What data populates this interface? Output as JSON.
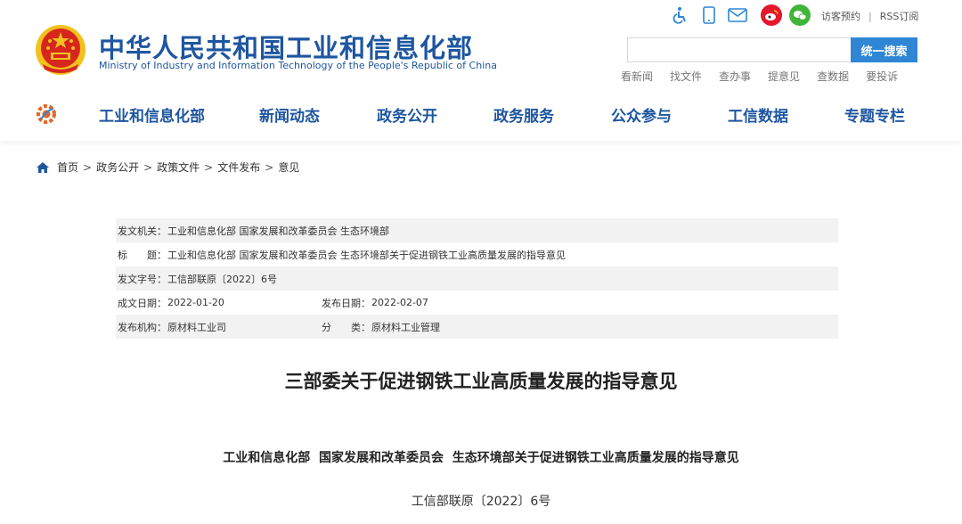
{
  "site": {
    "title": "中华人民共和国工业和信息化部",
    "subtitle": "Ministry of Industry and Information Technology of the People's Republic of China"
  },
  "top_bar": {
    "icons": [
      "accessibility-icon",
      "mobile-phone-icon",
      "mail-icon",
      "weibo-icon",
      "wechat-icon"
    ],
    "links": [
      "访客预约",
      "RSS订阅"
    ]
  },
  "search": {
    "placeholder": "",
    "button_label": "统一搜索"
  },
  "quick_links": [
    "看新闻",
    "找文件",
    "查办事",
    "提意见",
    "查数据",
    "要投诉"
  ],
  "nav": {
    "items": [
      "工业和信息化部",
      "新闻动态",
      "政务公开",
      "政务服务",
      "公众参与",
      "工信数据",
      "专题专栏"
    ]
  },
  "breadcrumb": [
    "首页",
    "政务公开",
    "政策文件",
    "文件发布",
    "意见"
  ],
  "meta": {
    "issuer": {
      "label": "发文机关：",
      "value": "工业和信息化部 国家发展和改革委员会 生态环境部"
    },
    "title": {
      "label": "标　　题：",
      "value": "工业和信息化部 国家发展和改革委员会 生态环境部关于促进钢铁工业高质量发展的指导意见"
    },
    "doc_no": {
      "label": "发文字号：",
      "value": "工信部联原〔2022〕6号"
    },
    "created": {
      "label": "成文日期：",
      "value": "2022-01-20"
    },
    "published": {
      "label": "发布日期：",
      "value": "2022-02-07"
    },
    "org": {
      "label": "发布机构：",
      "value": "原材料工业司"
    },
    "category": {
      "label": "分　　类：",
      "value": "原材料工业管理"
    }
  },
  "article": {
    "title": "三部委关于促进钢铁工业高质量发展的指导意见",
    "heading": "工业和信息化部  国家发展和改革委员会  生态环境部关于促进钢铁工业高质量发展的指导意见",
    "doc_no": "工信部联原〔2022〕6号"
  },
  "colors": {
    "brand_blue": "#1e56a0",
    "search_button": "#2f86d4",
    "emblem_red": "#d7261e",
    "emblem_gold": "#f2c11c",
    "weibo": "#e6162d",
    "wechat": "#3fb53a",
    "nav_logo_orange": "#e8621f"
  }
}
